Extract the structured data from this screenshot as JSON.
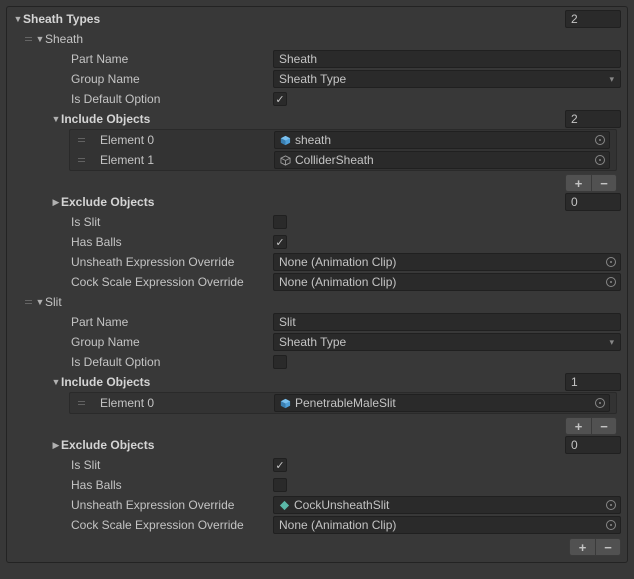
{
  "header": {
    "title": "Sheath Types",
    "size": "2"
  },
  "items": [
    {
      "name": "Sheath",
      "partName": "Sheath",
      "groupName": "Sheath Type",
      "isDefault": true,
      "include": {
        "label": "Include Objects",
        "size": "2",
        "elements": [
          {
            "label": "Element 0",
            "value": "sheath",
            "iconType": "prefab"
          },
          {
            "label": "Element 1",
            "value": "ColliderSheath",
            "iconType": "transform"
          }
        ]
      },
      "exclude": {
        "label": "Exclude Objects",
        "size": "0"
      },
      "isSlit": false,
      "hasBalls": true,
      "unsheathOverride": {
        "value": "None (Animation Clip)",
        "hasIcon": false
      },
      "scaleOverride": {
        "value": "None (Animation Clip)",
        "hasIcon": false
      }
    },
    {
      "name": "Slit",
      "partName": "Slit",
      "groupName": "Sheath Type",
      "isDefault": false,
      "include": {
        "label": "Include Objects",
        "size": "1",
        "elements": [
          {
            "label": "Element 0",
            "value": "PenetrableMaleSlit",
            "iconType": "prefab"
          }
        ]
      },
      "exclude": {
        "label": "Exclude Objects",
        "size": "0"
      },
      "isSlit": true,
      "hasBalls": false,
      "unsheathOverride": {
        "value": "CockUnsheathSlit",
        "hasIcon": true
      },
      "scaleOverride": {
        "value": "None (Animation Clip)",
        "hasIcon": false
      }
    }
  ],
  "labels": {
    "partName": "Part Name",
    "groupName": "Group Name",
    "isDefault": "Is Default Option",
    "isSlit": "Is Slit",
    "hasBalls": "Has Balls",
    "unsheath": "Unsheath Expression Override",
    "scale": "Cock Scale Expression Override"
  }
}
